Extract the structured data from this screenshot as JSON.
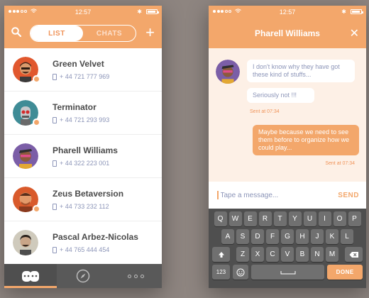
{
  "status_bar": {
    "time": "12:57"
  },
  "list_screen": {
    "tabs": {
      "list": "LIST",
      "chats": "CHATS"
    },
    "contacts": [
      {
        "name": "Green Velvet",
        "phone": "+ 44 721 777 969"
      },
      {
        "name": "Terminator",
        "phone": "+ 44 721 293 993"
      },
      {
        "name": "Pharell Williams",
        "phone": "+ 44 322 223 001"
      },
      {
        "name": "Zeus Betaversion",
        "phone": "+ 44 733 232 112"
      },
      {
        "name": "Pascal Arbez-Nicolas",
        "phone": "+ 44 765 444 454"
      }
    ]
  },
  "chat_screen": {
    "title": "Pharell Williams",
    "messages": [
      {
        "text": "I don't know why they have got these kind of stuffs..."
      },
      {
        "text": "Seriously not !!!"
      },
      {
        "sent": "Sent at  07:34"
      },
      {
        "text": "Maybe because we need to see them before to organize how we could play..."
      },
      {
        "sent": "Sent at  07:34"
      }
    ],
    "composer": {
      "placeholder": "Tape a message...",
      "send": "SEND"
    },
    "keyboard": {
      "row1": [
        "Q",
        "W",
        "E",
        "R",
        "T",
        "Y",
        "U",
        "I",
        "O",
        "P"
      ],
      "row2": [
        "A",
        "S",
        "D",
        "F",
        "G",
        "H",
        "J",
        "K",
        "L"
      ],
      "row3": [
        "Z",
        "X",
        "C",
        "V",
        "B",
        "N",
        "M"
      ],
      "numbers_key": "123",
      "done_key": "DONE"
    }
  },
  "colors": {
    "accent": "#f3a76b",
    "text_muted": "#8c95b8",
    "keyboard": "#4f4f4f"
  }
}
